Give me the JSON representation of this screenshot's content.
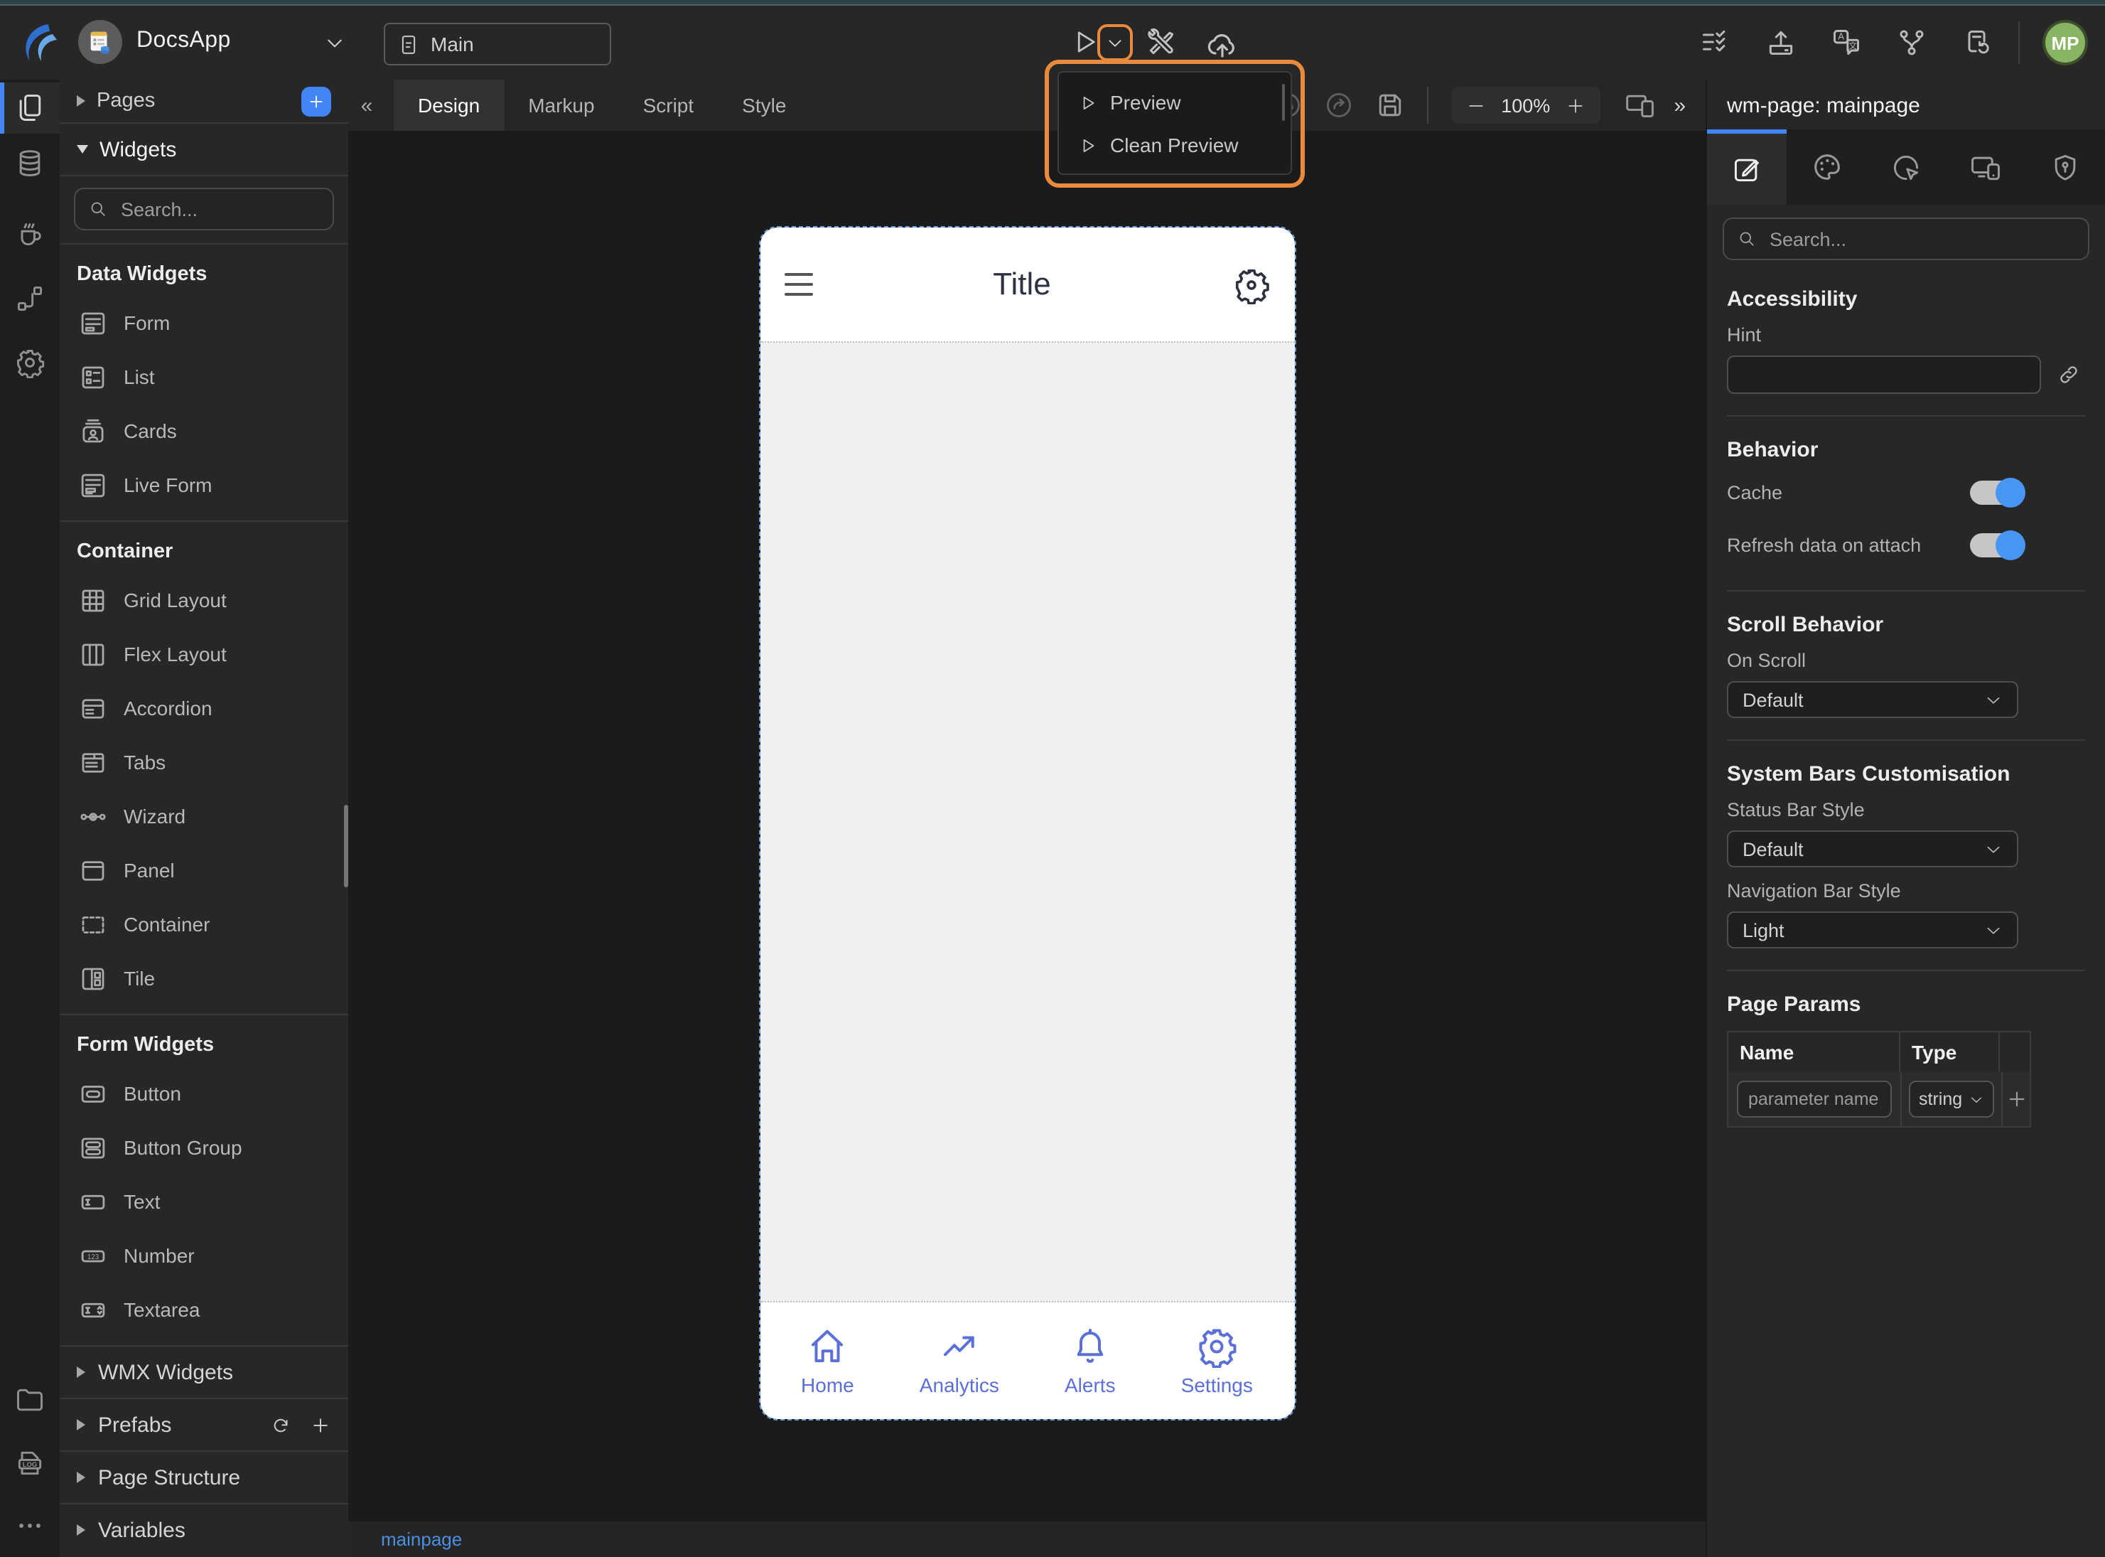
{
  "topbar": {
    "app_name": "DocsApp",
    "page_selector": "Main",
    "avatar_initials": "MP"
  },
  "preview_menu": {
    "items": [
      {
        "label": "Preview"
      },
      {
        "label": "Clean Preview"
      }
    ]
  },
  "widgets_panel": {
    "pages_label": "Pages",
    "widgets_label": "Widgets",
    "search_placeholder": "Search...",
    "groups": [
      {
        "title": "Data Widgets",
        "items": [
          {
            "label": "Form"
          },
          {
            "label": "List"
          },
          {
            "label": "Cards"
          },
          {
            "label": "Live Form"
          }
        ]
      },
      {
        "title": "Container",
        "items": [
          {
            "label": "Grid Layout"
          },
          {
            "label": "Flex Layout"
          },
          {
            "label": "Accordion"
          },
          {
            "label": "Tabs"
          },
          {
            "label": "Wizard"
          },
          {
            "label": "Panel"
          },
          {
            "label": "Container"
          },
          {
            "label": "Tile"
          }
        ]
      },
      {
        "title": "Form Widgets",
        "items": [
          {
            "label": "Button"
          },
          {
            "label": "Button Group"
          },
          {
            "label": "Text"
          },
          {
            "label": "Number"
          },
          {
            "label": "Textarea"
          }
        ]
      }
    ],
    "collapsed_sections": [
      {
        "label": "WMX Widgets"
      },
      {
        "label": "Prefabs"
      },
      {
        "label": "Page Structure"
      },
      {
        "label": "Variables"
      }
    ]
  },
  "canvas": {
    "collapse_left": "«",
    "expand_right": "»",
    "tabs": [
      {
        "label": "Design"
      },
      {
        "label": "Markup"
      },
      {
        "label": "Script"
      },
      {
        "label": "Style"
      }
    ],
    "zoom_level": "100%",
    "status_page": "mainpage"
  },
  "device_preview": {
    "title": "Title",
    "nav_items": [
      {
        "label": "Home"
      },
      {
        "label": "Analytics"
      },
      {
        "label": "Alerts"
      },
      {
        "label": "Settings"
      }
    ]
  },
  "inspector": {
    "title": "wm-page: mainpage",
    "search_placeholder": "Search...",
    "accessibility": {
      "title": "Accessibility",
      "hint_label": "Hint",
      "hint_value": ""
    },
    "behavior": {
      "title": "Behavior",
      "cache_label": "Cache",
      "refresh_label": "Refresh data on attach"
    },
    "scroll": {
      "title": "Scroll Behavior",
      "on_scroll_label": "On Scroll",
      "on_scroll_value": "Default"
    },
    "system_bars": {
      "title": "System Bars Customisation",
      "status_bar_label": "Status Bar Style",
      "status_bar_value": "Default",
      "nav_bar_label": "Navigation Bar Style",
      "nav_bar_value": "Light"
    },
    "page_params": {
      "title": "Page Params",
      "name_header": "Name",
      "type_header": "Type",
      "name_placeholder": "parameter name",
      "type_value": "string"
    }
  },
  "icon_text": {
    "log": "LOG",
    "translate_primary": "A",
    "translate_secondary": "文",
    "number": "123"
  },
  "colors": {
    "accent": "#4285f4",
    "highlight": "#e98a3c",
    "device_nav": "#5b6fd8",
    "avatar": "#87b563"
  }
}
